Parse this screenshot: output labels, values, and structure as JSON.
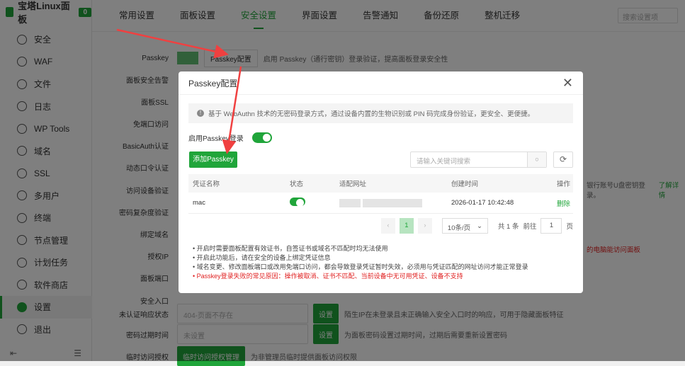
{
  "sidebar": {
    "brand": "宝塔Linux面板",
    "badge": "0",
    "items": [
      {
        "label": "安全",
        "icon": "shield-icon"
      },
      {
        "label": "WAF",
        "icon": "waf-icon"
      },
      {
        "label": "文件",
        "icon": "folder-icon"
      },
      {
        "label": "日志",
        "icon": "log-icon"
      },
      {
        "label": "WP Tools",
        "icon": "wordpress-icon"
      },
      {
        "label": "域名",
        "icon": "globe-icon"
      },
      {
        "label": "SSL",
        "icon": "ssl-icon"
      },
      {
        "label": "多用户",
        "icon": "users-icon"
      },
      {
        "label": "终端",
        "icon": "terminal-icon"
      },
      {
        "label": "节点管理",
        "icon": "node-icon"
      },
      {
        "label": "计划任务",
        "icon": "clock-icon"
      },
      {
        "label": "软件商店",
        "icon": "store-icon"
      },
      {
        "label": "设置",
        "icon": "gear-icon",
        "active": true
      },
      {
        "label": "退出",
        "icon": "logout-icon"
      }
    ],
    "bottom_left": "⇤",
    "bottom_right": "☰"
  },
  "tabs": [
    "常用设置",
    "面板设置",
    "安全设置",
    "界面设置",
    "告警通知",
    "备份还原",
    "整机迁移"
  ],
  "active_tab": "安全设置",
  "search_placeholder": "搜索设置项",
  "settings": {
    "passkey": {
      "label": "Passkey",
      "button": "Passkey配置",
      "desc": "启用 Passkey（通行密钥）登录验证，提高面板登录安全性"
    },
    "labels": [
      "面板安全告警",
      "面板SSL",
      "免端口访问",
      "BasicAuth认证",
      "动态口令认证",
      "访问设备验证",
      "密码复杂度验证",
      "绑定域名",
      "授权IP",
      "面板端口",
      "安全入口"
    ],
    "device_desc": "银行账号U盘密钥登录。",
    "device_link": "了解详情",
    "ip_desc": "的电脑能访问面板",
    "unauth": {
      "label": "未认证响应状态",
      "value": "404-页面不存在",
      "button": "设置",
      "desc": "陌生IP在未登录且未正确输入安全入口时的响应，可用于隐藏面板特征"
    },
    "pwd_expire": {
      "label": "密码过期时间",
      "value": "未设置",
      "button": "设置",
      "desc": "为面板密码设置过期时间，过期后需要重新设置密码"
    },
    "temp": {
      "label": "临时访问授权",
      "button": "临时访问授权管理",
      "desc": "为非管理员临时提供面板访问权限"
    }
  },
  "modal": {
    "title": "Passkey配置",
    "info": "基于 WebAuthn 技术的无密码登录方式，通过设备内置的生物识别或 PIN 码完成身份验证，更安全、更便捷。",
    "enable_label": "启用Passkey登录",
    "enabled": true,
    "add_button": "添加Passkey",
    "search_placeholder": "请输入关键词搜索",
    "columns": [
      "凭证名称",
      "状态",
      "适配网址",
      "创建时间",
      "操作"
    ],
    "rows": [
      {
        "name": "mac",
        "status": true,
        "created": "2026-01-17 10:42:48",
        "action": "删除"
      }
    ],
    "pager": {
      "prev": "‹",
      "page": "1",
      "next": "›",
      "per_page": "10条/页",
      "total": "共 1 条",
      "goto": "前往",
      "goto_value": "1",
      "page_unit": "页"
    },
    "notes": [
      "开启时需要面板配置有效证书，自签证书或域名不匹配时均无法使用",
      "开启此功能后，请在安全的设备上绑定凭证信息",
      "域名变更、修改面板端口或改用免端口访问，都会导致登录凭证暂时失效，必须用与凭证匹配的网址访问才能正常登录",
      "Passkey登录失败的常见原因：操作被取消、证书不匹配、当前设备中无可用凭证、设备不支持"
    ],
    "close": "✕"
  },
  "colors": {
    "accent": "#20a53a",
    "warning": "#e02020",
    "annotation_arrow": "#f04040"
  }
}
